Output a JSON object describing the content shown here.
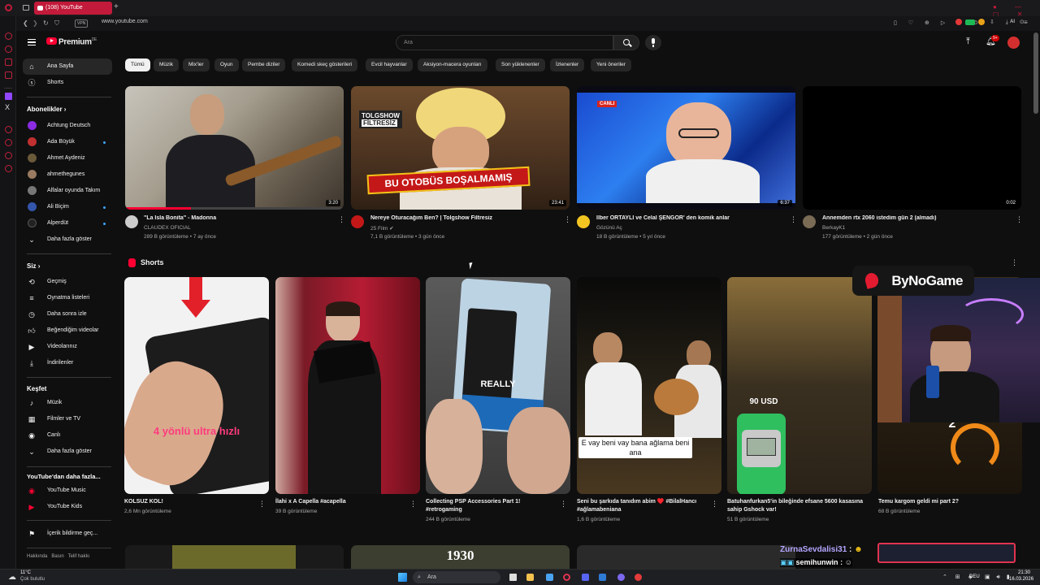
{
  "browser": {
    "tab_title": "(108) YouTube",
    "url": "www.youtube.com",
    "vpn_label": "VPN",
    "ai_label": "AI"
  },
  "header": {
    "logo": "Premium",
    "logo_region": "DE",
    "search_placeholder": "Ara",
    "notif_badge": "9+"
  },
  "nav": {
    "home": "Ana Sayfa",
    "shorts": "Shorts",
    "subs_title": "Abonelikler",
    "subs": [
      {
        "label": "Achtung Deutsch"
      },
      {
        "label": "Ada Büyük"
      },
      {
        "label": "Ahmet Aydeniz"
      },
      {
        "label": "ahmethegunes"
      },
      {
        "label": "Alfalar oyunda Takım"
      },
      {
        "label": "Ali Biçim"
      },
      {
        "label": "Alperdüt"
      }
    ],
    "subs_more": "Daha fazla göster",
    "you_title": "Siz",
    "you": [
      {
        "label": "Geçmiş"
      },
      {
        "label": "Oynatma listeleri"
      },
      {
        "label": "Daha sonra izle"
      },
      {
        "label": "Beğendiğim videolar"
      },
      {
        "label": "Videolarınız"
      },
      {
        "label": "İndirilenler"
      }
    ],
    "explore_title": "Keşfet",
    "explore": [
      {
        "label": "Müzik"
      },
      {
        "label": "Filmler ve TV"
      },
      {
        "label": "Canlı"
      },
      {
        "label": "Daha fazla göster"
      }
    ],
    "more_title": "YouTube'dan daha fazla...",
    "more": [
      {
        "label": "YouTube Music"
      },
      {
        "label": "YouTube Kids"
      }
    ],
    "report": "İçerik bildirme geç...",
    "footer": "Hakkında   Basın   Telif hakkı"
  },
  "chips": [
    "Tümü",
    "Müzik",
    "Mix'ler",
    "Oyun",
    "Pembe diziler",
    "Komedi skeç gösterileri",
    "Evcil hayvanlar",
    "Aksiyon-macera oyunları",
    "Son yüklenenler",
    "İzlenenler",
    "Yeni öneriler"
  ],
  "videos": [
    {
      "title": "\"La Isla Bonita\" - Madonna",
      "channel": "CLAUDEX OFICIAL",
      "meta": "289 B görüntüleme • 7 ay önce",
      "duration": "3:20"
    },
    {
      "title": "Nereye Oturacağım Ben? | Tolgshow Filtresiz",
      "channel": "25 Film",
      "meta": "7,1 B görüntüleme • 3 gün önce",
      "duration": "23:41",
      "overlay": "BU OTOBÜS BOŞALMAMIŞ",
      "brand": "TOLGSHOW",
      "brand2": "FİLTRESİZ"
    },
    {
      "title": "İlber ORTAYLI ve Celal ŞENGÖR' den komik anlar",
      "channel": "Gözünü Aç",
      "meta": "18 B görüntüleme • 5 yıl önce",
      "duration": "6:37",
      "live": "CANLI"
    },
    {
      "title": "Annemden rtx 2060 istedim gün 2 (almadı)",
      "channel": "BerkayK1",
      "meta": "177 görüntüleme • 2 gün önce",
      "duration": "0:02"
    }
  ],
  "shorts_title": "Shorts",
  "shorts": [
    {
      "title": "KOLSUZ KOL!",
      "views": "2,6 Mn görüntüleme",
      "overlay": "4 yönlü ultra hızlı"
    },
    {
      "title": "İlahi x A Capella #acapella",
      "views": "39 B görüntüleme"
    },
    {
      "title": "Collecting PSP Accessories Part 1! #retrogaming",
      "views": "244 B görüntüleme",
      "overlay": "REALLY"
    },
    {
      "title": "Seni bu şarkıda tanıdım abim ♥️ #BilalHancı #ağlamabeniana",
      "views": "1,6 B görüntüleme",
      "overlay": "E vay beni vay bana ağlama beni ana"
    },
    {
      "title": "Batuhanfurkan5'in bileğinde efsane 5600 kasasına sahip Gshock var!",
      "views": "51 B görüntüleme",
      "overlay": "90 USD"
    },
    {
      "title": "Temu kargom geldi mi part 2?",
      "views": "68 B görüntüleme",
      "overlay": "2"
    }
  ],
  "bottom_row": {
    "overlay": "1930"
  },
  "stream": {
    "brand": "ByNoGame",
    "chat": [
      {
        "user": "ZurnaSevdalisi31",
        "msg": ":"
      },
      {
        "user": "semihunwin",
        "msg": ":"
      }
    ]
  },
  "taskbar": {
    "weather_temp": "11°C",
    "weather_desc": "Çok bulutlu",
    "search": "Ara",
    "lang": "DEU",
    "time": "21:30",
    "date": "16.03.2026"
  },
  "colors": {
    "accent": "#ff0033",
    "opera": "#c21a3a",
    "bg": "#0f0f0f"
  }
}
